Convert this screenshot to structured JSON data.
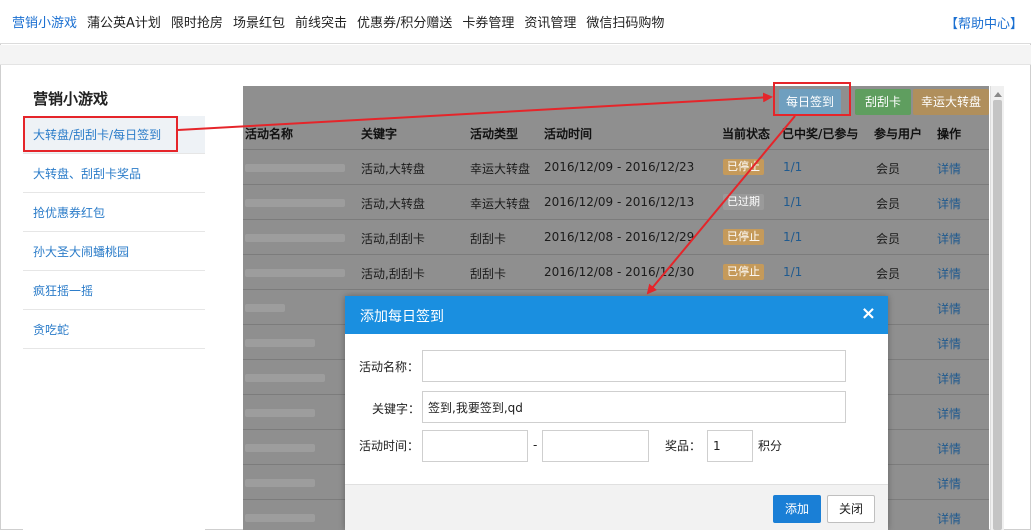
{
  "topnav": {
    "items": [
      {
        "label": "营销小游戏",
        "active": true
      },
      {
        "label": "蒲公英A计划"
      },
      {
        "label": "限时抢房"
      },
      {
        "label": "场景红包"
      },
      {
        "label": "前线突击"
      },
      {
        "label": "优惠券/积分赠送"
      },
      {
        "label": "卡券管理"
      },
      {
        "label": "资讯管理"
      },
      {
        "label": "微信扫码购物"
      }
    ],
    "help": "【帮助中心】"
  },
  "sidebar": {
    "title": "营销小游戏",
    "items": [
      {
        "label": "大转盘/刮刮卡/每日签到",
        "active": true
      },
      {
        "label": "大转盘、刮刮卡奖品"
      },
      {
        "label": "抢优惠券红包"
      },
      {
        "label": "孙大圣大闹蟠桃园"
      },
      {
        "label": "疯狂摇一摇"
      },
      {
        "label": "贪吃蛇"
      }
    ]
  },
  "toolbar": {
    "daily_checkin": "每日签到",
    "scratch_card": "刮刮卡",
    "lucky_wheel": "幸运大转盘"
  },
  "table": {
    "headers": [
      "活动名称",
      "关键字",
      "活动类型",
      "活动时间",
      "当前状态",
      "已中奖/已参与",
      "参与用户",
      "操作"
    ],
    "rows": [
      {
        "keyword": "活动,大转盘",
        "type": "幸运大转盘",
        "time": "2016/12/09 - 2016/12/23",
        "status": "已停止",
        "status_kind": "stop",
        "ratio": "1/1",
        "user": "会员",
        "action": "详情"
      },
      {
        "keyword": "活动,大转盘",
        "type": "幸运大转盘",
        "time": "2016/12/09 - 2016/12/13",
        "status": "已过期",
        "status_kind": "expired",
        "ratio": "1/1",
        "user": "会员",
        "action": "详情"
      },
      {
        "keyword": "活动,刮刮卡",
        "type": "刮刮卡",
        "time": "2016/12/08 - 2016/12/29",
        "status": "已停止",
        "status_kind": "stop",
        "ratio": "1/1",
        "user": "会员",
        "action": "详情"
      },
      {
        "keyword": "活动,刮刮卡",
        "type": "刮刮卡",
        "time": "2016/12/08 - 2016/12/30",
        "status": "已停止",
        "status_kind": "stop",
        "ratio": "1/1",
        "user": "会员",
        "action": "详情"
      },
      {
        "user": "员",
        "action": "详情"
      },
      {
        "user": "员",
        "action": "详情"
      },
      {
        "user": "员",
        "action": "详情"
      },
      {
        "user": "员",
        "action": "详情"
      },
      {
        "user": "员",
        "action": "详情"
      },
      {
        "user": "员",
        "action": "详情"
      },
      {
        "user": "员",
        "action": "详情"
      }
    ]
  },
  "dialog": {
    "title": "添加每日签到",
    "close_icon": "×",
    "name_label": "活动名称：",
    "name_value": "",
    "keyword_label": "关键字：",
    "keyword_value": "签到,我要签到,qd",
    "time_label": "活动时间：",
    "time_start": "",
    "time_sep": "-",
    "time_end": "",
    "prize_label": "奖品：",
    "prize_value": "1",
    "prize_unit": "积分",
    "add_button": "添加",
    "close_button": "关闭"
  },
  "colors": {
    "accent": "#1a8fe0",
    "link": "#2b7cc9",
    "highlight": "#e5252a"
  }
}
